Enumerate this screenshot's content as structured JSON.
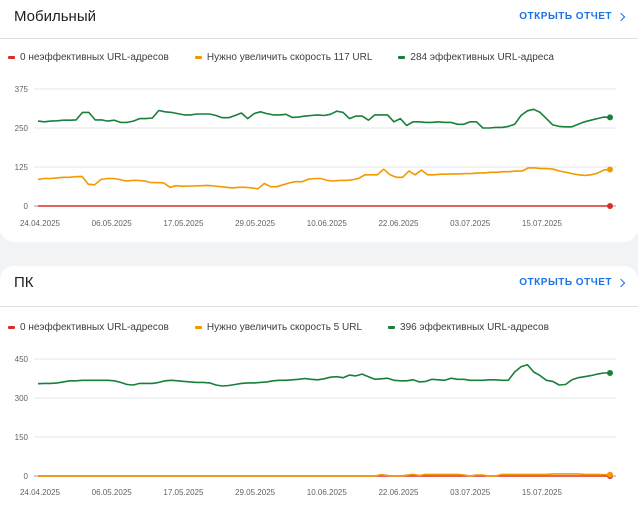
{
  "colors": {
    "red": "#d93025",
    "orange": "#f29900",
    "green": "#188038",
    "link": "#1a73e8",
    "grid": "#e6e6e6"
  },
  "cards": [
    {
      "title": "Мобильный",
      "link_label": "ОТКРЫТЬ ОТЧЕТ",
      "legend": [
        {
          "label": "0 неэффективных URL-адресов",
          "color": "#d93025"
        },
        {
          "label": "Нужно увеличить скорость 117 URL",
          "color": "#f29900"
        },
        {
          "label": "284 эффективных URL-адреса",
          "color": "#188038"
        }
      ]
    },
    {
      "title": "ПК",
      "link_label": "ОТКРЫТЬ ОТЧЕТ",
      "legend": [
        {
          "label": "0 неэффективных URL-адресов",
          "color": "#d93025"
        },
        {
          "label": "Нужно увеличить скорость 5 URL",
          "color": "#f29900"
        },
        {
          "label": "396 эффективных URL-адресов",
          "color": "#188038"
        }
      ]
    }
  ],
  "chart_data": [
    {
      "type": "line",
      "title": "Мобильный",
      "x_tick_labels": [
        "24.04.2025",
        "06.05.2025",
        "17.05.2025",
        "29.05.2025",
        "10.06.2025",
        "22.06.2025",
        "03.07.2025",
        "15.07.2025"
      ],
      "y_ticks": [
        0,
        125,
        250,
        375
      ],
      "ylim": [
        0,
        375
      ],
      "series": [
        {
          "name": "0 неэффективных URL-адресов",
          "color": "#d93025",
          "values": [
            0,
            0,
            0,
            0,
            0,
            0,
            0,
            0,
            0,
            0,
            0,
            0,
            0,
            0,
            0,
            0,
            0,
            0,
            0,
            0,
            0,
            0,
            0,
            0,
            0,
            0,
            0,
            0,
            0,
            0,
            0,
            0,
            0,
            0,
            0,
            0,
            0,
            0,
            0,
            0,
            0,
            0,
            0,
            0,
            0,
            0,
            0,
            0,
            0,
            0,
            0,
            0,
            0,
            0,
            0,
            0,
            0,
            0,
            0,
            0,
            0,
            0,
            0,
            0,
            0,
            0,
            0,
            0,
            0,
            0,
            0,
            0,
            0,
            0,
            0,
            0,
            0,
            0,
            0,
            0,
            0,
            0,
            0,
            0,
            0,
            0,
            0,
            0,
            0,
            0
          ]
        },
        {
          "name": "Нужно увеличить скорость 117 URL",
          "color": "#f29900",
          "values": [
            85,
            88,
            88,
            90,
            92,
            92,
            94,
            95,
            70,
            68,
            85,
            88,
            88,
            85,
            80,
            82,
            82,
            80,
            75,
            75,
            74,
            60,
            65,
            63,
            64,
            64,
            65,
            66,
            64,
            62,
            60,
            58,
            60,
            60,
            58,
            55,
            72,
            62,
            62,
            68,
            74,
            78,
            78,
            86,
            88,
            88,
            82,
            80,
            82,
            82,
            84,
            88,
            100,
            100,
            100,
            118,
            100,
            92,
            92,
            112,
            100,
            115,
            100,
            100,
            102,
            102,
            103,
            103,
            104,
            104,
            106,
            106,
            108,
            108,
            110,
            110,
            112,
            112,
            122,
            122,
            120,
            120,
            118,
            112,
            108,
            104,
            100,
            98,
            100,
            105,
            115,
            117
          ]
        },
        {
          "name": "284 эффективных URL-адреса",
          "color": "#188038",
          "values": [
            272,
            270,
            272,
            273,
            275,
            275,
            276,
            300,
            300,
            276,
            276,
            272,
            275,
            268,
            268,
            272,
            280,
            280,
            282,
            306,
            302,
            300,
            296,
            292,
            292,
            295,
            295,
            295,
            290,
            283,
            283,
            290,
            298,
            280,
            296,
            302,
            296,
            292,
            292,
            294,
            284,
            285,
            288,
            290,
            292,
            290,
            294,
            304,
            300,
            280,
            288,
            288,
            275,
            292,
            292,
            292,
            270,
            280,
            258,
            270,
            270,
            268,
            268,
            270,
            268,
            268,
            262,
            262,
            270,
            270,
            250,
            250,
            252,
            252,
            255,
            262,
            290,
            305,
            310,
            300,
            280,
            260,
            255,
            254,
            254,
            262,
            270,
            275,
            280,
            285,
            284
          ]
        }
      ]
    },
    {
      "type": "line",
      "title": "ПК",
      "x_tick_labels": [
        "24.04.2025",
        "06.05.2025",
        "17.05.2025",
        "29.05.2025",
        "10.06.2025",
        "22.06.2025",
        "03.07.2025",
        "15.07.2025"
      ],
      "y_ticks": [
        0,
        150,
        300,
        450
      ],
      "ylim": [
        0,
        450
      ],
      "series": [
        {
          "name": "0 неэффективных URL-адресов",
          "color": "#d93025",
          "values": [
            0,
            0,
            0,
            0,
            0,
            0,
            0,
            0,
            0,
            0,
            0,
            0,
            0,
            0,
            0,
            0,
            0,
            0,
            0,
            0,
            0,
            0,
            0,
            0,
            0,
            0,
            0,
            0,
            0,
            0,
            0,
            0,
            0,
            0,
            0,
            0,
            0,
            0,
            0,
            0,
            0,
            0,
            0,
            0,
            0,
            0,
            0,
            0,
            0,
            0,
            0,
            0,
            0,
            0,
            0,
            0,
            0,
            0,
            0,
            0,
            0,
            0,
            0,
            0,
            0,
            0,
            0,
            0,
            0,
            0,
            0,
            0,
            0,
            0,
            0,
            0,
            0,
            0,
            0,
            0,
            0,
            0,
            0,
            0,
            0,
            0,
            0,
            0,
            0,
            0,
            0
          ]
        },
        {
          "name": "Нужно увеличить скорость 5 URL",
          "color": "#f29900",
          "values": [
            0,
            0,
            0,
            0,
            0,
            0,
            0,
            0,
            0,
            0,
            0,
            0,
            0,
            0,
            0,
            0,
            0,
            0,
            0,
            0,
            0,
            0,
            0,
            0,
            0,
            0,
            0,
            0,
            0,
            0,
            0,
            0,
            0,
            0,
            0,
            0,
            0,
            0,
            0,
            0,
            0,
            0,
            0,
            0,
            0,
            0,
            0,
            0,
            0,
            0,
            0,
            0,
            0,
            0,
            5,
            2,
            0,
            0,
            3,
            6,
            2,
            6,
            6,
            6,
            6,
            6,
            6,
            4,
            0,
            4,
            4,
            0,
            0,
            6,
            6,
            6,
            6,
            6,
            6,
            6,
            6,
            8,
            8,
            8,
            8,
            8,
            6,
            6,
            6,
            5,
            5
          ]
        },
        {
          "name": "396 эффективных URL-адресов",
          "color": "#188038",
          "values": [
            355,
            356,
            356,
            358,
            362,
            366,
            366,
            368,
            368,
            368,
            368,
            368,
            366,
            360,
            352,
            350,
            356,
            356,
            356,
            360,
            366,
            368,
            366,
            364,
            362,
            360,
            360,
            358,
            350,
            346,
            348,
            352,
            356,
            358,
            358,
            360,
            362,
            366,
            368,
            368,
            370,
            372,
            375,
            372,
            370,
            374,
            380,
            382,
            378,
            388,
            385,
            392,
            382,
            372,
            374,
            376,
            368,
            366,
            366,
            370,
            362,
            364,
            372,
            370,
            368,
            376,
            372,
            372,
            368,
            368,
            368,
            370,
            370,
            368,
            368,
            400,
            420,
            428,
            400,
            386,
            368,
            364,
            350,
            352,
            370,
            378,
            382,
            386,
            392,
            396,
            396
          ]
        }
      ]
    }
  ]
}
